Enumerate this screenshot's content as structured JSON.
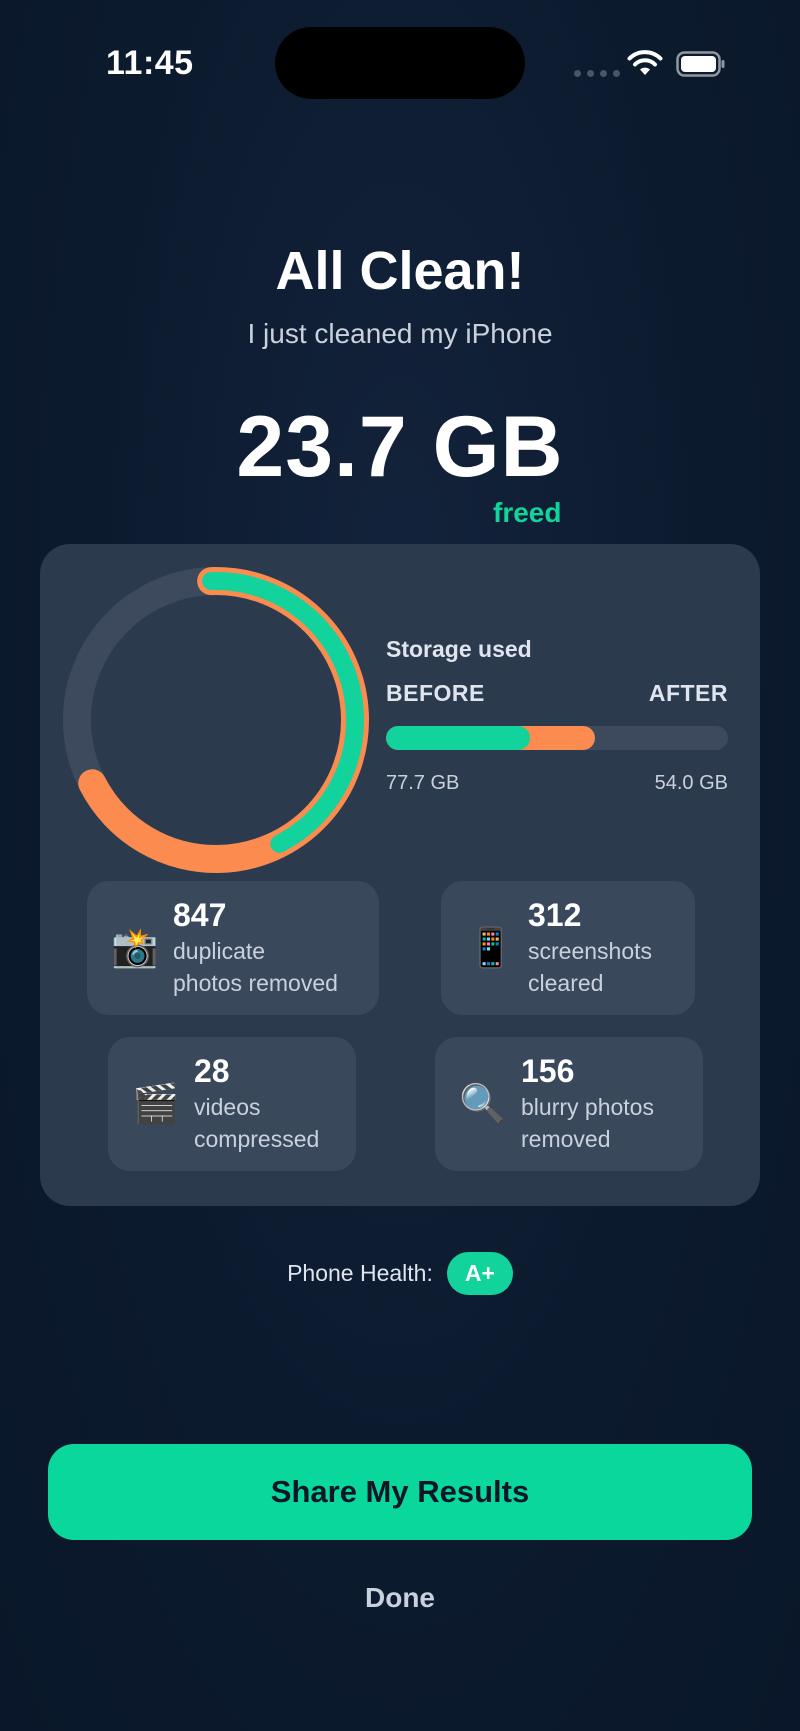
{
  "status_bar": {
    "time": "11:45",
    "signal_icon": "cellular-signal-icon",
    "wifi_icon": "wifi-icon",
    "battery_icon": "battery-icon"
  },
  "header": {
    "title": "All Clean!",
    "subtitle": "I just cleaned my iPhone"
  },
  "result": {
    "amount": "23.7 GB",
    "unit_label": "freed"
  },
  "colors": {
    "accent": "#12d39b",
    "orange": "#fb8b4e",
    "background": "#0c1a2e",
    "card": "#2c3a4d",
    "tile": "#3a485b"
  },
  "storage": {
    "title": "Storage used",
    "before_label": "BEFORE",
    "after_label": "AFTER",
    "before_value": "77.7 GB",
    "after_value": "54.0 GB",
    "before_fraction": 0.42,
    "after_fraction": 0.61
  },
  "ring": {
    "track_color": "#3d4a5d",
    "after_fraction": 0.68,
    "before_fraction": 0.43
  },
  "stats": [
    {
      "icon": "camera-flash-icon",
      "emoji": "📸",
      "count": "847",
      "line1": "duplicate",
      "line2": "photos removed"
    },
    {
      "icon": "mobile-phone-icon",
      "emoji": "📱",
      "count": "312",
      "line1": "screenshots",
      "line2": "cleared"
    },
    {
      "icon": "clapper-board-icon",
      "emoji": "🎬",
      "count": "28",
      "line1": "videos",
      "line2": "compressed"
    },
    {
      "icon": "magnifying-glass-icon",
      "emoji": "🔍",
      "count": "156",
      "line1": "blurry photos",
      "line2": "removed"
    }
  ],
  "health": {
    "label": "Phone Health:",
    "grade": "A+"
  },
  "actions": {
    "share_label": "Share My Results",
    "done_label": "Done"
  }
}
